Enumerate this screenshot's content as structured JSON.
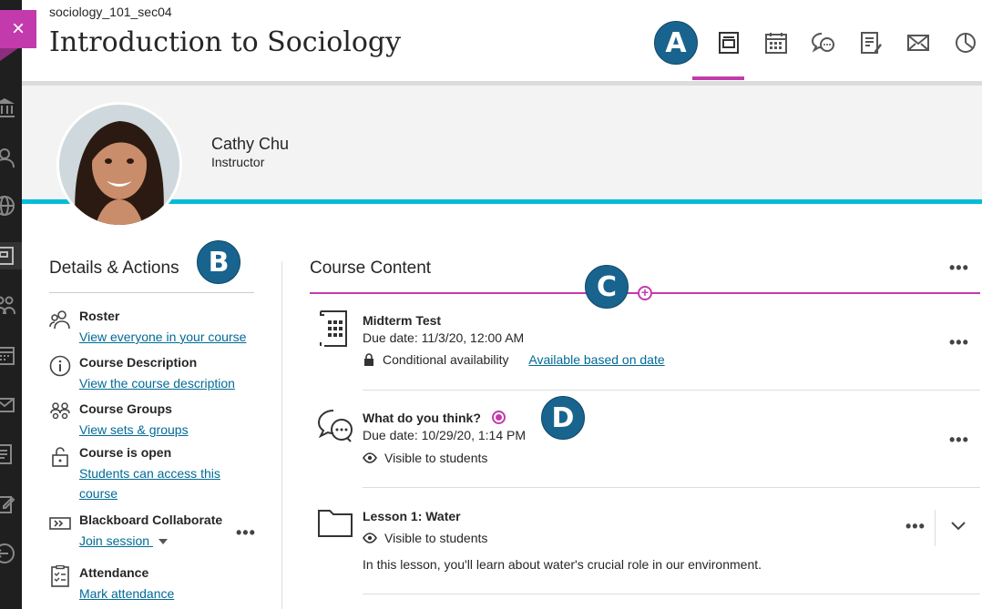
{
  "header": {
    "course_id": "sociology_101_sec04",
    "course_title": "Introduction to Sociology",
    "close_label": "×"
  },
  "instructor": {
    "name": "Cathy Chu",
    "role": "Instructor"
  },
  "badges": {
    "a": "A",
    "b": "B",
    "c": "C",
    "d": "D"
  },
  "details": {
    "title": "Details & Actions",
    "items": [
      {
        "title": "Roster",
        "link": "View everyone in your course"
      },
      {
        "title": "Course Description",
        "link": "View the course description"
      },
      {
        "title": "Course Groups",
        "link": "View sets & groups"
      },
      {
        "title": "Course is open",
        "link_line1": "Students can access this",
        "link_line2": "course"
      },
      {
        "title": "Blackboard Collaborate",
        "link": "Join session"
      },
      {
        "title": "Attendance",
        "link": "Mark attendance"
      }
    ]
  },
  "content": {
    "title": "Course Content",
    "items": [
      {
        "title": "Midterm Test",
        "due": "Due date: 11/3/20, 12:00 AM",
        "status": "Conditional availability",
        "status_link": "Available based on date"
      },
      {
        "title": "What do you think?",
        "due": "Due date: 10/29/20, 1:14 PM",
        "status": "Visible to students"
      },
      {
        "title": "Lesson 1: Water",
        "status": "Visible to students",
        "description": "In this lesson, you'll learn about water's crucial role in our environment."
      }
    ]
  },
  "more_label": "•••",
  "colors": {
    "accent": "#c33aad",
    "link": "#006a95",
    "badge": "#19648f",
    "cyan": "#00bcd9"
  }
}
